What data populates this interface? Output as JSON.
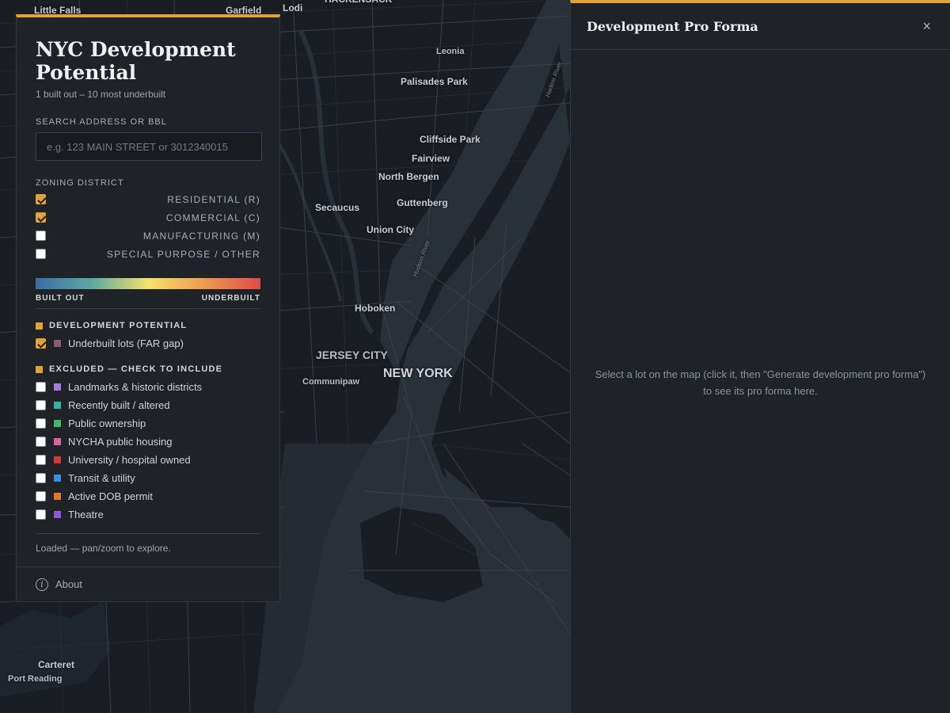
{
  "map": {
    "places": [
      {
        "name": "Little Falls",
        "size": "md"
      },
      {
        "name": "Garfield",
        "size": "md"
      },
      {
        "name": "Lodi",
        "size": "md"
      },
      {
        "name": "HACKENSACK",
        "size": "md"
      },
      {
        "name": "Leonia",
        "size": "sm"
      },
      {
        "name": "Palisades Park",
        "size": "md"
      },
      {
        "name": "Cliffside Park",
        "size": "md"
      },
      {
        "name": "Fairview",
        "size": "md"
      },
      {
        "name": "North Bergen",
        "size": "md"
      },
      {
        "name": "Secaucus",
        "size": "md"
      },
      {
        "name": "Guttenberg",
        "size": "md"
      },
      {
        "name": "Union City",
        "size": "md"
      },
      {
        "name": "Hoboken",
        "size": "md"
      },
      {
        "name": "JERSEY CITY",
        "size": "lg"
      },
      {
        "name": "NEW YORK",
        "size": "xl"
      },
      {
        "name": "Communipaw",
        "size": "sm"
      },
      {
        "name": "Carteret",
        "size": "md"
      },
      {
        "name": "Port Reading",
        "size": "sm"
      },
      {
        "name": "Hudson River",
        "size": "water"
      },
      {
        "name": "Harlem River",
        "size": "water"
      }
    ]
  },
  "panel": {
    "title": "NYC Development Potential",
    "subtitle": "1 built out – 10 most underbuilt",
    "search": {
      "label": "SEARCH ADDRESS OR BBL",
      "placeholder": "e.g. 123 MAIN STREET or 3012340015"
    },
    "zoning": {
      "label": "ZONING DISTRICT",
      "items": [
        {
          "label": "RESIDENTIAL (R)",
          "checked": true
        },
        {
          "label": "COMMERCIAL (C)",
          "checked": true
        },
        {
          "label": "MANUFACTURING (M)",
          "checked": false
        },
        {
          "label": "SPECIAL PURPOSE / OTHER",
          "checked": false
        }
      ]
    },
    "scale": {
      "low": "BUILT OUT",
      "high": "UNDERBUILT"
    },
    "development": {
      "label": "DEVELOPMENT POTENTIAL",
      "items": [
        {
          "label": "Underbuilt lots (FAR gap)",
          "checked": true,
          "color": "#8a5a78"
        }
      ]
    },
    "excluded": {
      "label": "EXCLUDED — CHECK TO INCLUDE",
      "items": [
        {
          "label": "Landmarks & historic districts",
          "checked": false,
          "color": "#a37ee0"
        },
        {
          "label": "Recently built / altered",
          "checked": false,
          "color": "#3aaea4"
        },
        {
          "label": "Public ownership",
          "checked": false,
          "color": "#3fb86a"
        },
        {
          "label": "NYCHA public housing",
          "checked": false,
          "color": "#e060a6"
        },
        {
          "label": "University / hospital owned",
          "checked": false,
          "color": "#d23a3a"
        },
        {
          "label": "Transit & utility",
          "checked": false,
          "color": "#3a8fe0"
        },
        {
          "label": "Active DOB permit",
          "checked": false,
          "color": "#e0782e"
        },
        {
          "label": "Theatre",
          "checked": false,
          "color": "#8a5ad6"
        }
      ]
    },
    "status": "Loaded — pan/zoom to explore.",
    "about": "About"
  },
  "proforma": {
    "title": "Development Pro Forma",
    "close": "×",
    "empty": "Select a lot on the map (click it, then \"Generate development pro forma\") to see its pro forma here."
  },
  "colors": {
    "accent": "#e0a33a",
    "panel": "#1f2227",
    "water": "#2a3038",
    "land": "#1a1d21"
  }
}
